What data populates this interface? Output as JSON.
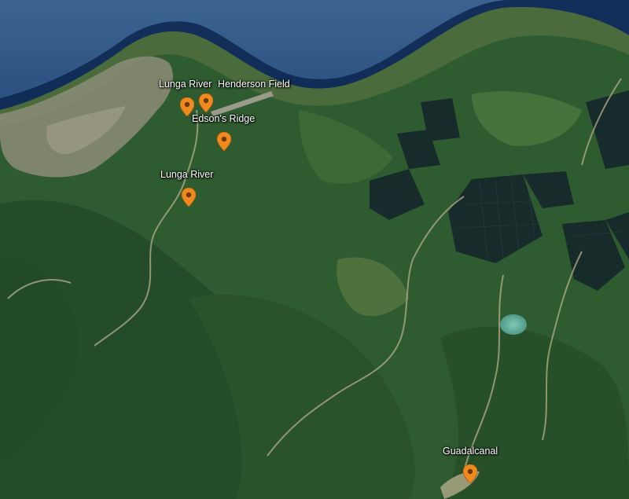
{
  "map": {
    "type": "satellite",
    "colors": {
      "ocean_deep": "#0b2a5e",
      "ocean_shallow": "#2a5080",
      "forest": "#2d5a30",
      "forest_dark": "#1e4222",
      "plantation": "#1a2a2e",
      "urban": "#8a8f7a",
      "marker": "#f08a1e"
    },
    "markers": [
      {
        "label": "Lunga River",
        "icon": "map-pin-icon"
      },
      {
        "label": "Henderson Field",
        "icon": "map-pin-icon"
      },
      {
        "label": "Edson's Ridge",
        "icon": "map-pin-icon"
      },
      {
        "label": "Lunga River",
        "icon": "map-pin-icon"
      },
      {
        "label": "Guadalcanal",
        "icon": "map-pin-icon"
      }
    ]
  }
}
